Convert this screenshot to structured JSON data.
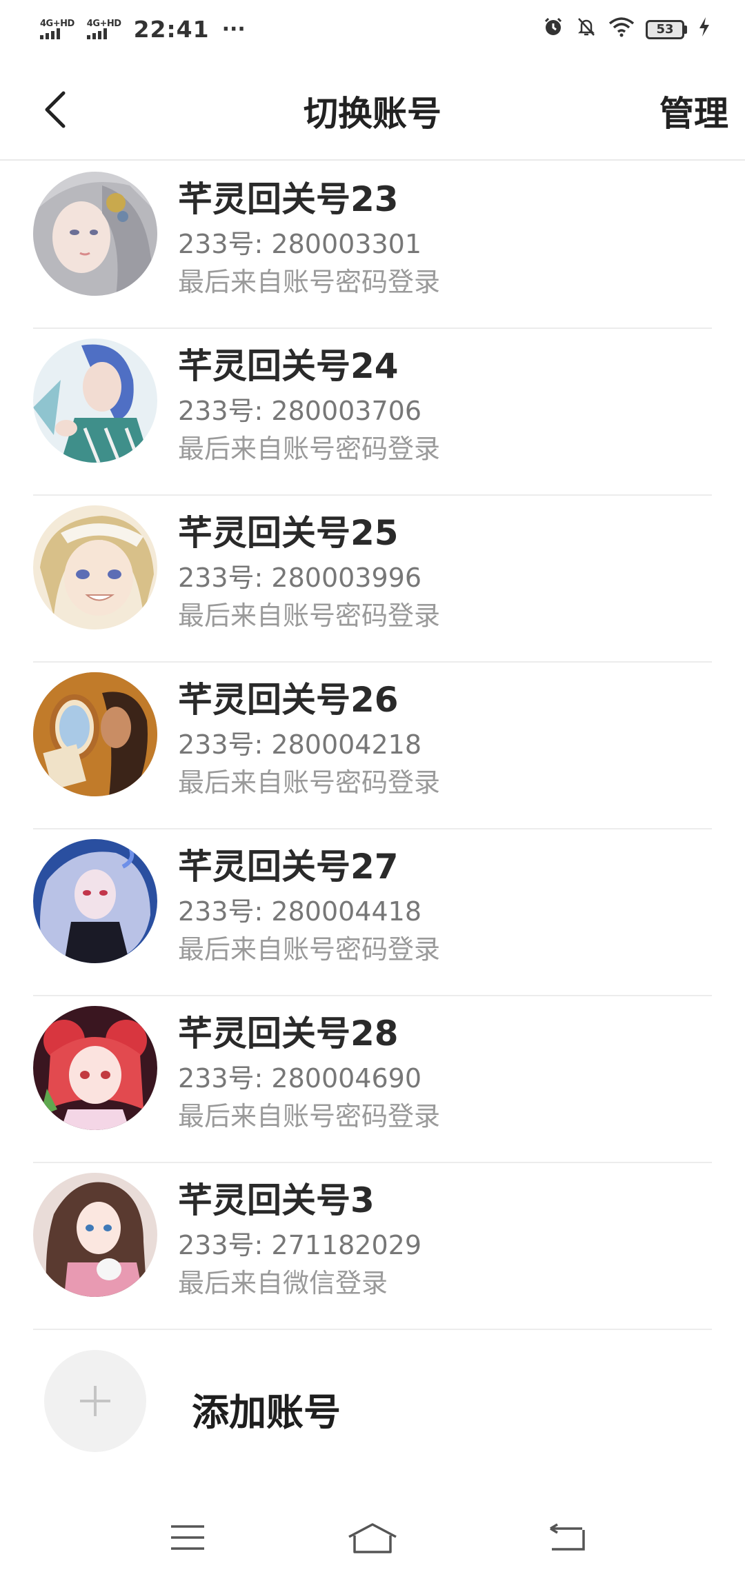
{
  "status_bar": {
    "signal_1_label": "4G+HD",
    "signal_2_label": "4G+HD",
    "time": "22:41",
    "more": "···",
    "battery": "53"
  },
  "header": {
    "title": "切换账号",
    "manage_label": "管理",
    "back_icon": "chevron-left-icon"
  },
  "accounts": [
    {
      "name": "芊灵回关号23",
      "uid": "233号: 280003301",
      "login_source": "最后来自账号密码登录"
    },
    {
      "name": "芊灵回关号24",
      "uid": "233号: 280003706",
      "login_source": "最后来自账号密码登录"
    },
    {
      "name": "芊灵回关号25",
      "uid": "233号: 280003996",
      "login_source": "最后来自账号密码登录"
    },
    {
      "name": "芊灵回关号26",
      "uid": "233号: 280004218",
      "login_source": "最后来自账号密码登录"
    },
    {
      "name": "芊灵回关号27",
      "uid": "233号: 280004418",
      "login_source": "最后来自账号密码登录"
    },
    {
      "name": "芊灵回关号28",
      "uid": "233号: 280004690",
      "login_source": "最后来自账号密码登录"
    },
    {
      "name": "芊灵回关号3",
      "uid": "233号: 271182029",
      "login_source": "最后来自微信登录"
    }
  ],
  "add_account": {
    "label": "添加账号",
    "icon": "plus-icon"
  },
  "nav_bar": {
    "menu_icon": "menu-icon",
    "home_icon": "home-icon",
    "back_icon": "back-icon"
  }
}
